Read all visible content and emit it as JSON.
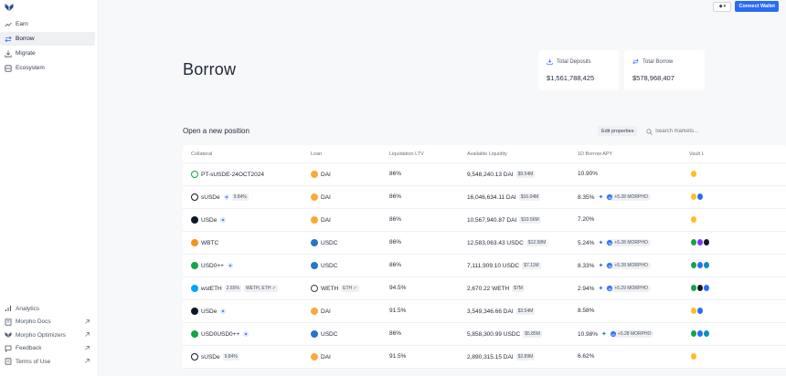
{
  "sidebar": {
    "nav": [
      {
        "label": "Earn",
        "icon": "trend-up-icon",
        "active": false
      },
      {
        "label": "Borrow",
        "icon": "swap-icon",
        "active": true
      },
      {
        "label": "Migrate",
        "icon": "download-icon",
        "active": false
      },
      {
        "label": "Ecosystem",
        "icon": "grid-icon",
        "active": false
      }
    ],
    "bottom": [
      {
        "label": "Analytics",
        "icon": "bar-chart-icon",
        "external": false
      },
      {
        "label": "Morpho Docs",
        "icon": "book-icon",
        "external": true
      },
      {
        "label": "Morpho Optimizers",
        "icon": "morpho-logo-icon",
        "external": true
      },
      {
        "label": "Feedback",
        "icon": "chat-icon",
        "external": true
      },
      {
        "label": "Terms of Use",
        "icon": "document-icon",
        "external": true
      }
    ]
  },
  "header": {
    "connect_label": "Connect Wallet"
  },
  "page": {
    "title": "Borrow",
    "stats": {
      "deposits_label": "Total Deposits",
      "deposits_value": "$1,561,788,425",
      "borrow_label": "Total Borrow",
      "borrow_value": "$578,968,407"
    },
    "section_title": "Open a new position",
    "edit_label": "Edit properties",
    "search_placeholder": "Search markets..."
  },
  "table": {
    "headers": [
      "Collateral",
      "Loan",
      "Liquidation LTV",
      "Available Liquidity",
      "1D Borrow APY",
      "Vault L"
    ],
    "rows": [
      {
        "collateral": "PT-sUSDE-24OCT2024",
        "coll_color": "#ffffff",
        "coll_ring": "#16a34a",
        "coll_badges": [],
        "coll_info": false,
        "loan": "DAI",
        "loan_color": "#f5ac37",
        "loan_badges": [],
        "ltv": "86%",
        "liq": "9,548,240.13 DAI",
        "liq_usd": "$9.54M",
        "apy": "10.90%",
        "morpho": "",
        "vault": [
          "#fbbf24"
        ]
      },
      {
        "collateral": "sUSDe",
        "coll_color": "#ffffff",
        "coll_ring": "#111827",
        "coll_badges": [
          "9.84%"
        ],
        "coll_info": true,
        "loan": "DAI",
        "loan_color": "#f5ac37",
        "loan_badges": [],
        "ltv": "86%",
        "liq": "16,046,634.11 DAI",
        "liq_usd": "$16.04M",
        "apy": "8.35%",
        "morpho": "+5.28 MORPHO",
        "vault": [
          "#fbbf24",
          "#2a6cf5"
        ]
      },
      {
        "collateral": "USDe",
        "coll_color": "#111827",
        "coll_ring": "#111827",
        "coll_badges": [],
        "coll_info": true,
        "loan": "DAI",
        "loan_color": "#f5ac37",
        "loan_badges": [],
        "ltv": "86%",
        "liq": "10,567,940.87 DAI",
        "liq_usd": "$10.56M",
        "apy": "7.20%",
        "morpho": "",
        "vault": [
          "#fbbf24"
        ]
      },
      {
        "collateral": "WBTC",
        "coll_color": "#f7931a",
        "coll_ring": "#f7931a",
        "coll_badges": [],
        "coll_info": false,
        "loan": "USDC",
        "loan_color": "#2775ca",
        "loan_badges": [],
        "ltv": "86%",
        "liq": "12,583,063.43 USDC",
        "liq_usd": "$12.58M",
        "apy": "5.24%",
        "morpho": "+5.28 MORPHO",
        "vault": [
          "#16a34a",
          "#7c3aed",
          "#111827"
        ]
      },
      {
        "collateral": "USD0++",
        "coll_color": "#16a34a",
        "coll_ring": "#16a34a",
        "coll_badges": [],
        "coll_info": true,
        "loan": "USDC",
        "loan_color": "#2775ca",
        "loan_badges": [],
        "ltv": "86%",
        "liq": "7,111,909.10 USDC",
        "liq_usd": "$7.11M",
        "apy": "8.33%",
        "morpho": "+5.28 MORPHO",
        "vault": [
          "#16a34a",
          "#2a6cf5",
          "#0891b2"
        ]
      },
      {
        "collateral": "wstETH",
        "coll_color": "#00a3ff",
        "coll_ring": "#00a3ff",
        "coll_badges": [
          "2.65%",
          "WETH, ETH ✓"
        ],
        "coll_info": false,
        "loan": "WETH",
        "loan_color": "#ffffff",
        "loan_badges": [
          "ETH ✓"
        ],
        "ltv": "94.5%",
        "liq": "2,670.22 WETH",
        "liq_usd": "$7M",
        "apy": "2.94%",
        "morpho": "+5.29 MORPHO",
        "vault": [
          "#16a34a",
          "#111827",
          "#2a6cf5"
        ]
      },
      {
        "collateral": "USDe",
        "coll_color": "#111827",
        "coll_ring": "#111827",
        "coll_badges": [],
        "coll_info": true,
        "loan": "DAI",
        "loan_color": "#f5ac37",
        "loan_badges": [],
        "ltv": "91.5%",
        "liq": "3,549,346.66 DAI",
        "liq_usd": "$3.54M",
        "apy": "8.58%",
        "morpho": "",
        "vault": [
          "#fbbf24",
          "#2a6cf5"
        ]
      },
      {
        "collateral": "USD0USD0++",
        "coll_color": "#16a34a",
        "coll_ring": "#16a34a",
        "coll_badges": [],
        "coll_info": true,
        "loan": "USDC",
        "loan_color": "#2775ca",
        "loan_badges": [],
        "ltv": "86%",
        "liq": "5,858,300.99 USDC",
        "liq_usd": "$5.85M",
        "apy": "10.98%",
        "morpho": "+5.28 MORPHO",
        "vault": [
          "#16a34a",
          "#2a6cf5",
          "#0891b2"
        ]
      },
      {
        "collateral": "sUSDe",
        "coll_color": "#ffffff",
        "coll_ring": "#111827",
        "coll_badges": [
          "9.84%"
        ],
        "coll_info": false,
        "loan": "DAI",
        "loan_color": "#f5ac37",
        "loan_badges": [],
        "ltv": "91.5%",
        "liq": "2,890,315.15 DAI",
        "liq_usd": "$2.89M",
        "apy": "6.62%",
        "morpho": "",
        "vault": [
          "#fbbf24"
        ]
      }
    ]
  },
  "colors": {
    "accent": "#2a6cf5",
    "background": "#f7f8fa"
  }
}
